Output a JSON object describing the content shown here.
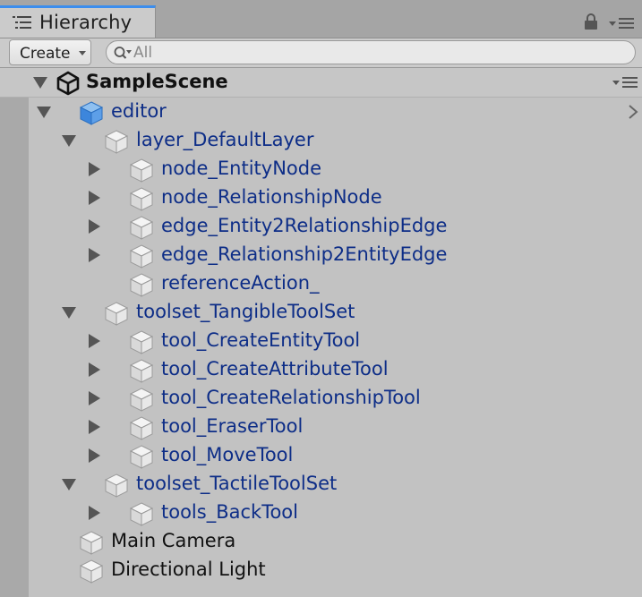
{
  "window": {
    "tab_title": "Hierarchy",
    "tab_icon": "list-icon",
    "lock_icon": "lock-icon",
    "menu_icon": "menu-icon"
  },
  "toolbar": {
    "create_label": "Create",
    "search_placeholder": "All",
    "search_value": ""
  },
  "scene": {
    "name": "SampleScene",
    "icon": "unity-icon"
  },
  "colors": {
    "prefab_text": "#0d2d87",
    "plain_text": "#111111",
    "accent": "#3b8ded",
    "background": "#c2c2c2"
  },
  "tree": [
    {
      "label": "editor",
      "depth": 0,
      "foldout": "open",
      "prefab": true,
      "selected_icon": true,
      "has_arrow": true
    },
    {
      "label": "layer_DefaultLayer",
      "depth": 1,
      "foldout": "open",
      "prefab": true
    },
    {
      "label": "node_EntityNode",
      "depth": 2,
      "foldout": "closed",
      "prefab": true
    },
    {
      "label": "node_RelationshipNode",
      "depth": 2,
      "foldout": "closed",
      "prefab": true
    },
    {
      "label": "edge_Entity2RelationshipEdge",
      "depth": 2,
      "foldout": "closed",
      "prefab": true
    },
    {
      "label": "edge_Relationship2EntityEdge",
      "depth": 2,
      "foldout": "closed",
      "prefab": true
    },
    {
      "label": "referenceAction_",
      "depth": 2,
      "foldout": "none",
      "prefab": true
    },
    {
      "label": "toolset_TangibleToolSet",
      "depth": 1,
      "foldout": "open",
      "prefab": true
    },
    {
      "label": "tool_CreateEntityTool",
      "depth": 2,
      "foldout": "closed",
      "prefab": true
    },
    {
      "label": "tool_CreateAttributeTool",
      "depth": 2,
      "foldout": "closed",
      "prefab": true
    },
    {
      "label": "tool_CreateRelationshipTool",
      "depth": 2,
      "foldout": "closed",
      "prefab": true
    },
    {
      "label": "tool_EraserTool",
      "depth": 2,
      "foldout": "closed",
      "prefab": true
    },
    {
      "label": "tool_MoveTool",
      "depth": 2,
      "foldout": "closed",
      "prefab": true
    },
    {
      "label": "toolset_TactileToolSet",
      "depth": 1,
      "foldout": "open",
      "prefab": true
    },
    {
      "label": "tools_BackTool",
      "depth": 2,
      "foldout": "closed",
      "prefab": true
    },
    {
      "label": "Main Camera",
      "depth": 0,
      "foldout": "none",
      "prefab": false
    },
    {
      "label": "Directional Light",
      "depth": 0,
      "foldout": "none",
      "prefab": false
    }
  ]
}
